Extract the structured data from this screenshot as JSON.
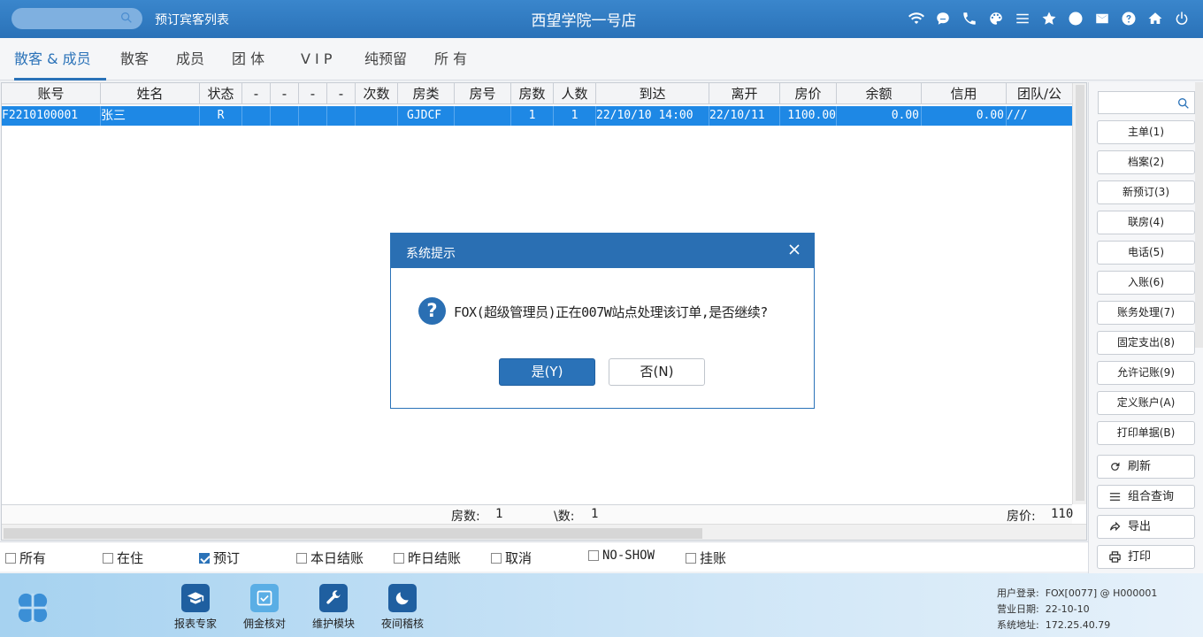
{
  "titlebar": {
    "search_placeholder": "",
    "section_title": "预订宾客列表",
    "hotel_name": "西望学院一号店",
    "icons": [
      "wifi-icon",
      "chat-icon",
      "phone-icon",
      "palette-icon",
      "menu-icon",
      "star-icon",
      "contrast-icon",
      "mail-icon",
      "help-icon",
      "home-icon",
      "power-icon"
    ]
  },
  "tabs": [
    {
      "label": "散客 & 成员",
      "active": true
    },
    {
      "label": "散客"
    },
    {
      "label": "成员"
    },
    {
      "label": "团 体"
    },
    {
      "label": "V I P"
    },
    {
      "label": "纯预留"
    },
    {
      "label": "所 有"
    }
  ],
  "grid": {
    "headers": [
      "账号",
      "姓名",
      "状态",
      "-",
      "-",
      "-",
      "-",
      "次数",
      "房类",
      "房号",
      "房数",
      "人数",
      "到达",
      "离开",
      "房价",
      "余额",
      "信用",
      "团队/公"
    ],
    "rows": [
      [
        "F2210100001",
        "张三",
        "R",
        "",
        "",
        "",
        "",
        "",
        "GJDCF",
        "",
        "1",
        "1",
        "22/10/10 14:00",
        "22/10/11",
        "1100.00",
        "0.00",
        "0.00",
        "///"
      ]
    ],
    "summary": {
      "rooms_label": "房数:",
      "rooms_value": "1",
      "people_label": "\\数:",
      "people_value": "1",
      "price_label": "房价:",
      "price_value": "110"
    }
  },
  "filters": [
    {
      "label": "所有",
      "checked": false
    },
    {
      "label": "在住",
      "checked": false
    },
    {
      "label": "预订",
      "checked": true
    },
    {
      "label": "本日结账",
      "checked": false
    },
    {
      "label": "昨日结账",
      "checked": false
    },
    {
      "label": "取消",
      "checked": false
    },
    {
      "label": "NO-SHOW",
      "checked": false
    },
    {
      "label": "挂账",
      "checked": false
    }
  ],
  "side": {
    "buttons": [
      "主单(1)",
      "档案(2)",
      "新预订(3)",
      "联房(4)",
      "电话(5)",
      "入账(6)",
      "账务处理(7)",
      "固定支出(8)",
      "允许记账(9)",
      "定义账户(A)",
      "打印单据(B)"
    ],
    "icon_buttons": [
      {
        "label": "刷新",
        "icon": "refresh-icon"
      },
      {
        "label": "组合查询",
        "icon": "list-icon"
      },
      {
        "label": "导出",
        "icon": "export-icon"
      },
      {
        "label": "打印",
        "icon": "printer-icon"
      }
    ]
  },
  "bottombar": {
    "items": [
      {
        "label": "报表专家",
        "icon": "graduation-cap-icon"
      },
      {
        "label": "佣金核对",
        "icon": "check-box-icon"
      },
      {
        "label": "维护模块",
        "icon": "wrench-icon"
      },
      {
        "label": "夜间稽核",
        "icon": "moon-icon"
      }
    ],
    "info": {
      "login_label": "用户登录:",
      "login_value": "FOX[0077] @ H000001",
      "date_label": "营业日期:",
      "date_value": "22-10-10",
      "addr_label": "系统地址:",
      "addr_value": "172.25.40.79"
    }
  },
  "dialog": {
    "title": "系统提示",
    "message": "FOX(超级管理员)正在007W站点处理该订单,是否继续?",
    "yes_label": "是(Y)",
    "no_label": "否(N)"
  }
}
